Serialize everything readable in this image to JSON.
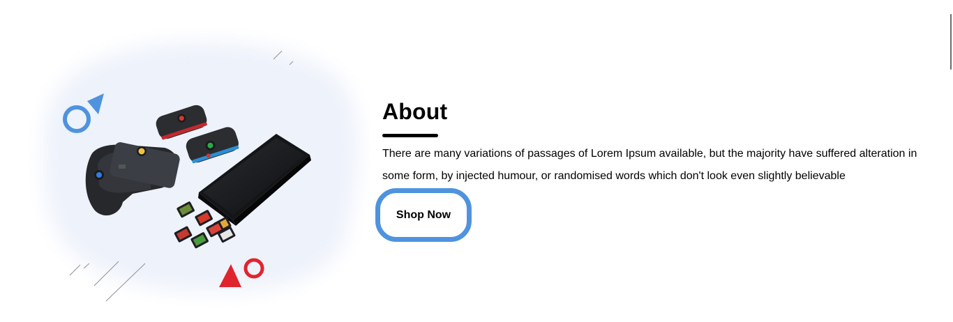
{
  "about": {
    "title": "About",
    "description": "There are many variations of passages of Lorem Ipsum available, but the majority have suffered alteration in some form, by injected humour, or randomised words which don't look even slightly believable",
    "button_label": "Shop Now"
  },
  "illustration": {
    "image_name": "game-console-accessories-image",
    "icons": [
      "blue-circle-icon",
      "blue-triangle-icon",
      "red-triangle-icon",
      "red-circle-icon"
    ]
  },
  "colors": {
    "accent_blue": "#4f93de",
    "accent_red": "#e0242e",
    "text": "#000000",
    "blob": "#eef2fb"
  }
}
